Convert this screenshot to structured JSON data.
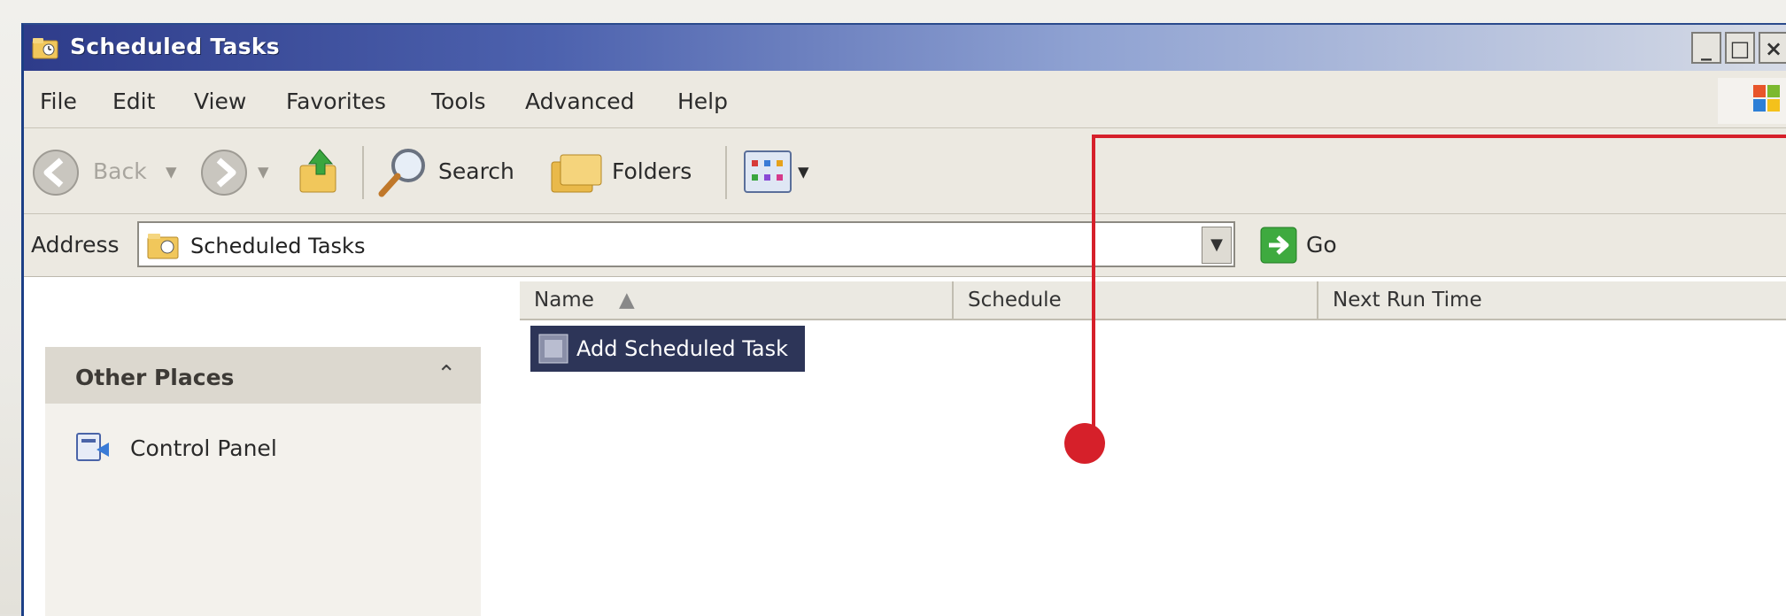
{
  "window": {
    "title": "Scheduled Tasks"
  },
  "menubar": {
    "items": [
      "File",
      "Edit",
      "View",
      "Favorites",
      "Tools",
      "Advanced",
      "Help"
    ]
  },
  "toolbar": {
    "back_label": "Back",
    "search_label": "Search",
    "folders_label": "Folders"
  },
  "address": {
    "label": "Address",
    "value": "Scheduled Tasks",
    "go_label": "Go"
  },
  "columns": [
    "Name",
    "Schedule",
    "Next Run Time"
  ],
  "tasks": [
    {
      "name": "Add Scheduled Task"
    }
  ],
  "left_panel": {
    "title": "Other Places",
    "links": [
      "Control Panel"
    ]
  },
  "colors": {
    "titlebar": "#2e3c8a",
    "selection": "#2d3558",
    "callout": "#d6202a"
  }
}
